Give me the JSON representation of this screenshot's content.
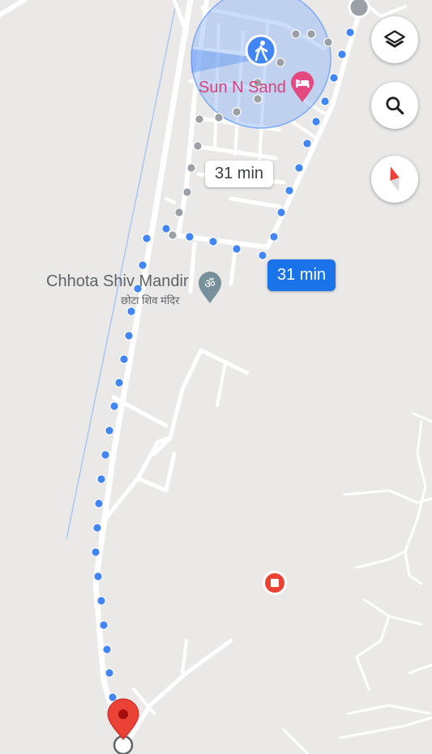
{
  "map": {
    "places": {
      "hotel_name": "Sun N Sand",
      "temple_name_en": "Chhota Shiv Mandir",
      "temple_name_hi": "छोटा शिव मंदिर"
    },
    "routes": {
      "alt_route_time": "31 min",
      "selected_route_time": "31 min"
    },
    "colors": {
      "route_blue": "#4285f4",
      "alt_route_gray": "#9aa0a6",
      "hotel_pink": "#e3497f",
      "pin_red": "#ea4335"
    }
  },
  "controls": {
    "layers_icon": "layers-icon",
    "search_icon": "search-icon",
    "compass_icon": "compass-icon"
  }
}
